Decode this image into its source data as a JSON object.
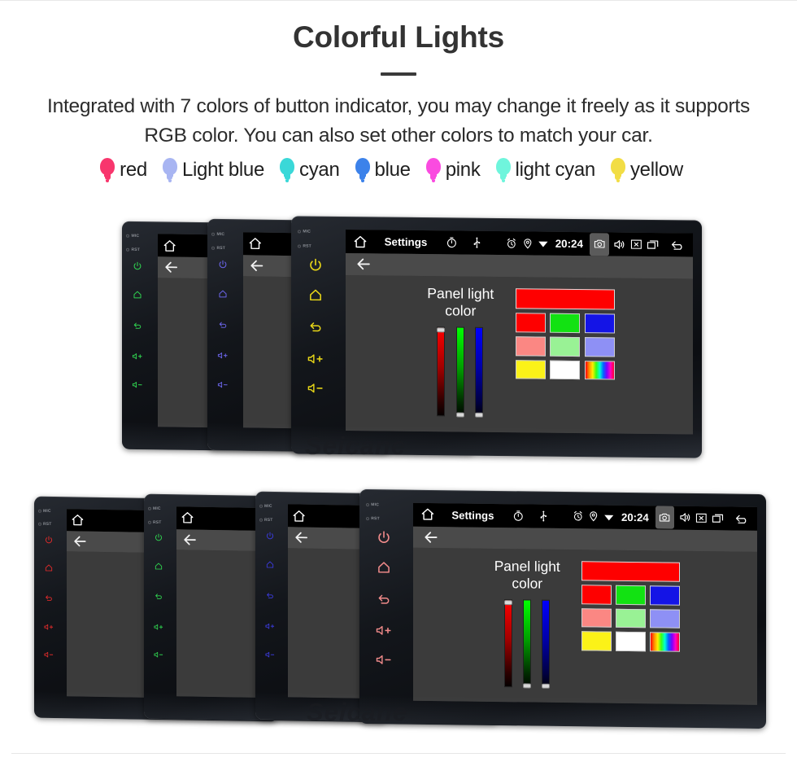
{
  "header": {
    "title": "Colorful Lights",
    "subtitle": "Integrated with 7 colors of button indicator, you may change it freely as it supports RGB color. You can also set other colors to match your car."
  },
  "legend": {
    "items": [
      {
        "label": "red",
        "color": "#f8366d",
        "icon": "bulb-icon"
      },
      {
        "label": "Light blue",
        "color": "#a8b5f2",
        "icon": "bulb-icon"
      },
      {
        "label": "cyan",
        "color": "#3ad8d8",
        "icon": "bulb-icon"
      },
      {
        "label": "blue",
        "color": "#3c82ea",
        "icon": "bulb-icon"
      },
      {
        "label": "pink",
        "color": "#fa4be0",
        "icon": "bulb-icon"
      },
      {
        "label": "light cyan",
        "color": "#6ff5dc",
        "icon": "bulb-icon"
      },
      {
        "label": "yellow",
        "color": "#f2dd45",
        "icon": "bulb-icon"
      }
    ]
  },
  "statusbar": {
    "home_icon": "home-icon",
    "title": "Settings",
    "timer_icon": "timer-icon",
    "usb_icon": "usb-icon",
    "alarm_icon": "alarm-icon",
    "location_icon": "location-icon",
    "wifi_icon": "wifi-icon",
    "time": "20:24",
    "camera_icon": "camera-icon",
    "volume_icon": "volume-icon",
    "close_icon": "close-box-icon",
    "recents_icon": "recents-icon",
    "back_icon": "back-arrow-icon"
  },
  "actionbar": {
    "back_icon": "back-arrow-icon"
  },
  "rail": {
    "mic_label": "MIC",
    "rst_label": "RST",
    "buttons": [
      {
        "name": "power-button",
        "icon": "power-icon"
      },
      {
        "name": "home-button",
        "icon": "home-outline-icon"
      },
      {
        "name": "back-button",
        "icon": "back-curve-icon"
      },
      {
        "name": "volume-up-button",
        "icon": "volume-plus-icon"
      },
      {
        "name": "volume-down-button",
        "icon": "volume-minus-icon"
      }
    ]
  },
  "picker": {
    "label": "Panel light color",
    "sliders": [
      {
        "name": "red-slider",
        "channel": "R",
        "value": 100
      },
      {
        "name": "green-slider",
        "channel": "G",
        "value": 0
      },
      {
        "name": "blue-slider",
        "channel": "B",
        "value": 0
      }
    ],
    "preview_color": "#fe0000",
    "swatches": [
      {
        "name": "swatch-red",
        "color": "#fe0000"
      },
      {
        "name": "swatch-green",
        "color": "#12e212"
      },
      {
        "name": "swatch-blue",
        "color": "#1414e6"
      },
      {
        "name": "swatch-light-red",
        "color": "#fb8783"
      },
      {
        "name": "swatch-light-green",
        "color": "#99f295"
      },
      {
        "name": "swatch-light-blue",
        "color": "#8e90f5"
      },
      {
        "name": "swatch-yellow",
        "color": "#fbf218"
      },
      {
        "name": "swatch-white",
        "color": "#ffffff"
      },
      {
        "name": "swatch-rainbow",
        "color": "rainbow"
      }
    ]
  },
  "devices": {
    "top_group": {
      "units": [
        {
          "name": "device-unit-top-green",
          "led_color": "#2fd14f"
        },
        {
          "name": "device-unit-top-purple",
          "led_color": "#6a64e8"
        },
        {
          "name": "device-unit-top-yellow",
          "led_color": "#e8d617"
        }
      ]
    },
    "bottom_group": {
      "units": [
        {
          "name": "device-unit-bottom-red",
          "led_color": "#e02b2b"
        },
        {
          "name": "device-unit-bottom-green",
          "led_color": "#2fd14f"
        },
        {
          "name": "device-unit-bottom-blue",
          "led_color": "#3b3bdd"
        },
        {
          "name": "device-unit-bottom-pink",
          "led_color": "#f08a8a"
        }
      ]
    }
  },
  "watermark": {
    "text": "Seicane"
  }
}
